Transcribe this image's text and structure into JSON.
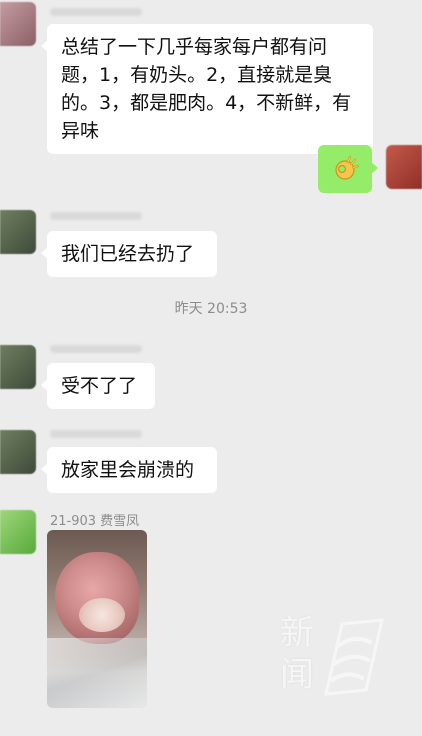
{
  "messages": [
    {
      "id": "m1",
      "text": "总结了一下几乎每家每户都有问题，1，有奶头。2，直接就是臭的。3，都是肥肉。4，不新鲜，有异味"
    },
    {
      "id": "m2",
      "emoji": "ok-hand-icon"
    },
    {
      "id": "m3",
      "text": "我们已经去扔了"
    },
    {
      "id": "m4",
      "text": "受不了了"
    },
    {
      "id": "m5",
      "text": "放家里会崩溃的"
    }
  ],
  "timestamp": "昨天 20:53",
  "image_message": {
    "sender": "21-903 费雪凤"
  },
  "watermark": {
    "text": "新闻",
    "logo": "logo-icon"
  },
  "colors": {
    "background": "#ececec",
    "incoming": "#ffffff",
    "outgoing": "#95ec69",
    "time": "#8c8c8c"
  }
}
